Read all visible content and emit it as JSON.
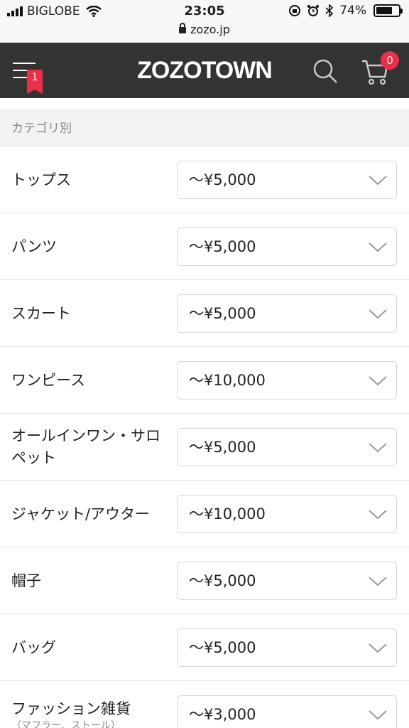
{
  "status_bar": {
    "carrier": "BIGLOBE",
    "time": "23:05",
    "battery": "74%",
    "battery_level": 0.74
  },
  "url_bar": {
    "domain": "zozo.jp"
  },
  "header": {
    "logo": "ZOZOTOWN",
    "menu_badge": "1",
    "cart_count": "0",
    "accent_color": "#e8304a",
    "background_color": "#333333"
  },
  "category_section": {
    "title": "カテゴリ別",
    "rows": [
      {
        "label": "トップス",
        "sub": "",
        "value": "〜¥5,000"
      },
      {
        "label": "パンツ",
        "sub": "",
        "value": "〜¥5,000"
      },
      {
        "label": "スカート",
        "sub": "",
        "value": "〜¥5,000"
      },
      {
        "label": "ワンピース",
        "sub": "",
        "value": "〜¥10,000"
      },
      {
        "label": "オールインワン・サロペット",
        "sub": "",
        "value": "〜¥5,000"
      },
      {
        "label": "ジャケット/アウター",
        "sub": "",
        "value": "〜¥10,000"
      },
      {
        "label": "帽子",
        "sub": "",
        "value": "〜¥5,000"
      },
      {
        "label": "バッグ",
        "sub": "",
        "value": "〜¥5,000"
      },
      {
        "label": "ファッション雑貨",
        "sub": "（マフラー、ストール）",
        "value": "〜¥3,000"
      }
    ]
  },
  "icons": {
    "menu": "hamburger-icon",
    "search": "search-icon",
    "cart": "cart-icon",
    "select_arrow": "chevron-down-icon"
  }
}
